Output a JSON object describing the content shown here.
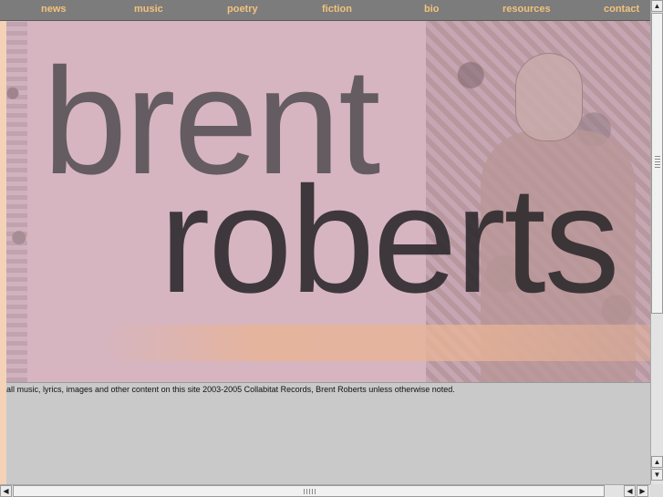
{
  "nav": {
    "items": [
      "news",
      "music",
      "poetry",
      "fiction",
      "bio",
      "resources",
      "contact"
    ]
  },
  "hero": {
    "first_name": "brent",
    "last_name": "roberts"
  },
  "footer": {
    "copyright": "all music, lyrics, images and other content on this site 2003-2005 Collabitat Records, Brent Roberts unless otherwise noted."
  },
  "scrollbars": {
    "up": "▲",
    "down": "▼",
    "left": "◀",
    "right": "▶"
  },
  "colors": {
    "nav_bg": "#7c7c7c",
    "nav_text": "#f2c27d",
    "hero_bg": "#d6b5c1",
    "page_bg": "#c8c8c8"
  }
}
